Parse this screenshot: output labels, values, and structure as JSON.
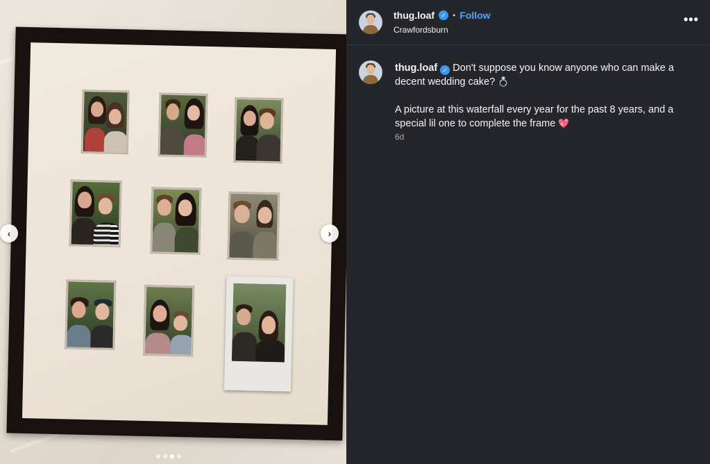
{
  "post": {
    "username": "thug.loaf",
    "follow_label": "Follow",
    "separator": "•",
    "location": "Crawfordsburn",
    "more_label": "•••",
    "verified_glyph": "✓"
  },
  "caption": {
    "username": "thug.loaf",
    "line1": "Don't suppose you know anyone who can make a decent wedding cake?",
    "line1_emoji": "💍",
    "line2": "A picture at this waterfall every year for the past 8 years, and a special lil one to complete the frame",
    "line2_emoji": "💖",
    "timestamp": "6d"
  },
  "carousel": {
    "prev_label": "‹",
    "next_label": "›",
    "dot_count": 4,
    "active_dot": 2
  },
  "colors": {
    "panel_bg": "#25262c",
    "follow_blue": "#5aa2f5",
    "verified_blue": "#3897f0"
  },
  "icons": {
    "prev": "chevron-left-icon",
    "next": "chevron-right-icon",
    "verified": "verified-badge-icon",
    "more": "more-options-icon"
  }
}
